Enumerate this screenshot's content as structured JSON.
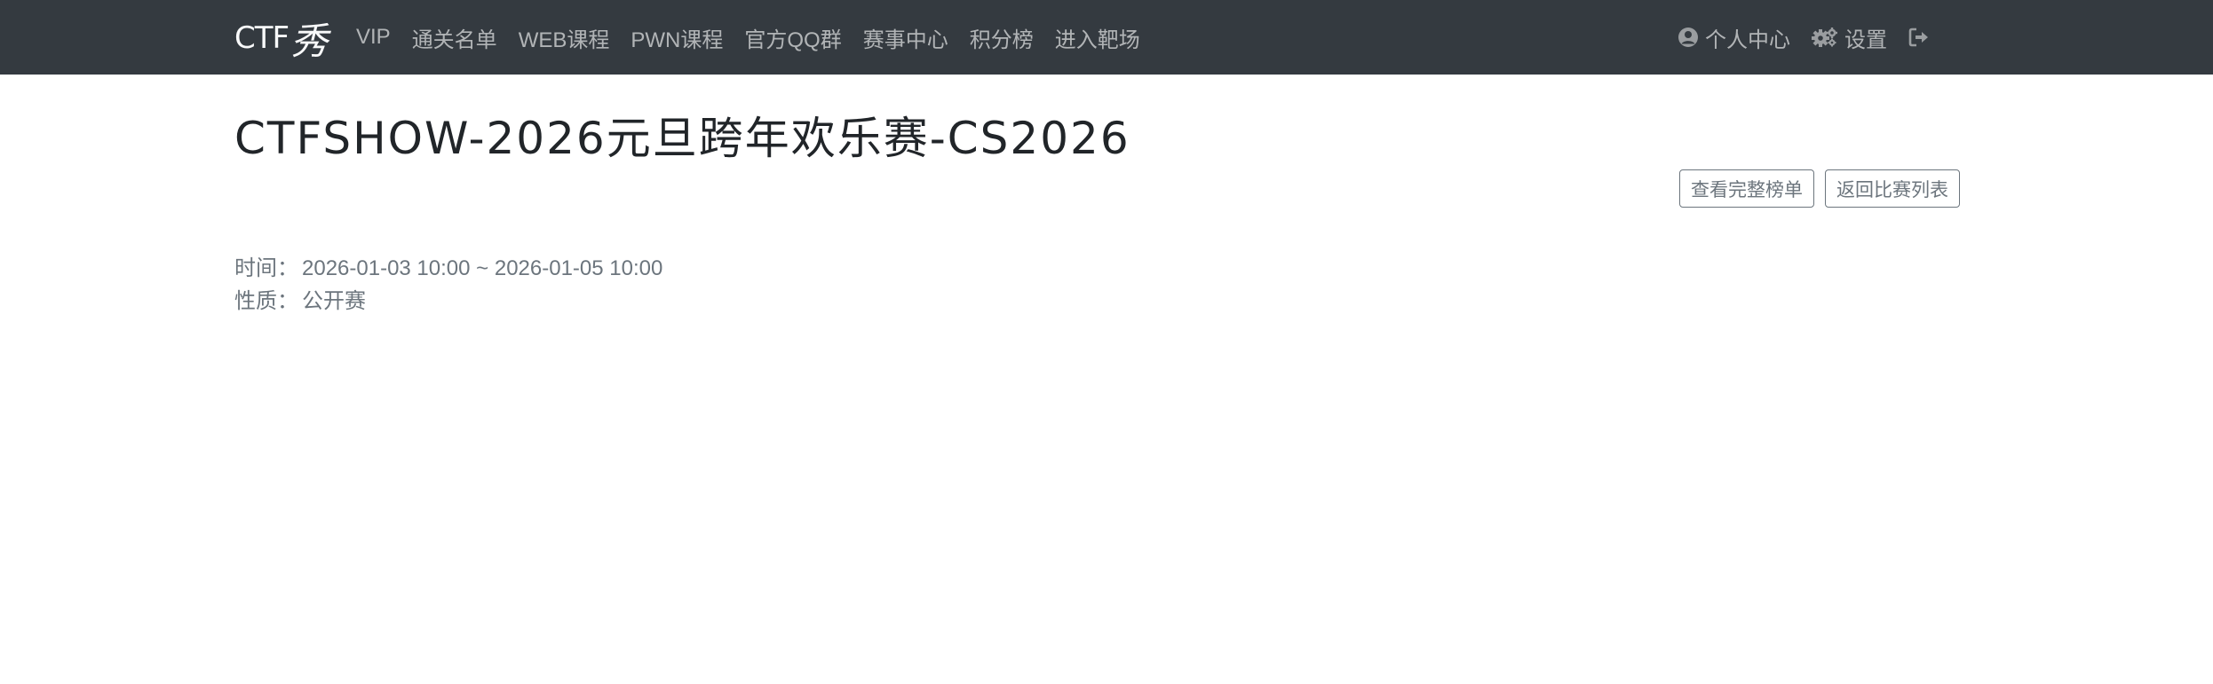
{
  "navbar": {
    "brand_text": "CTF",
    "brand_mark": "秀",
    "links": [
      "VIP",
      "通关名单",
      "WEB课程",
      "PWN课程",
      "官方QQ群",
      "赛事中心",
      "积分榜",
      "进入靶场"
    ],
    "profile_label": "个人中心",
    "settings_label": "设置",
    "icons": {
      "profile": "user-circle-icon",
      "settings": "gears-icon",
      "logout": "sign-out-icon"
    }
  },
  "page": {
    "title": "CTFSHOW-2026元旦跨年欢乐赛-CS2026",
    "buttons": {
      "leaderboard": "查看完整榜单",
      "back": "返回比赛列表"
    },
    "time_label": "时间：",
    "time_value": "2026-01-03 10:00 ~ 2026-01-05 10:00",
    "type_label": "性质：",
    "type_value": "公开赛"
  },
  "colors": {
    "navbar_bg": "#343a40",
    "nav_text": "#9a9da0",
    "muted": "#6c757d"
  }
}
